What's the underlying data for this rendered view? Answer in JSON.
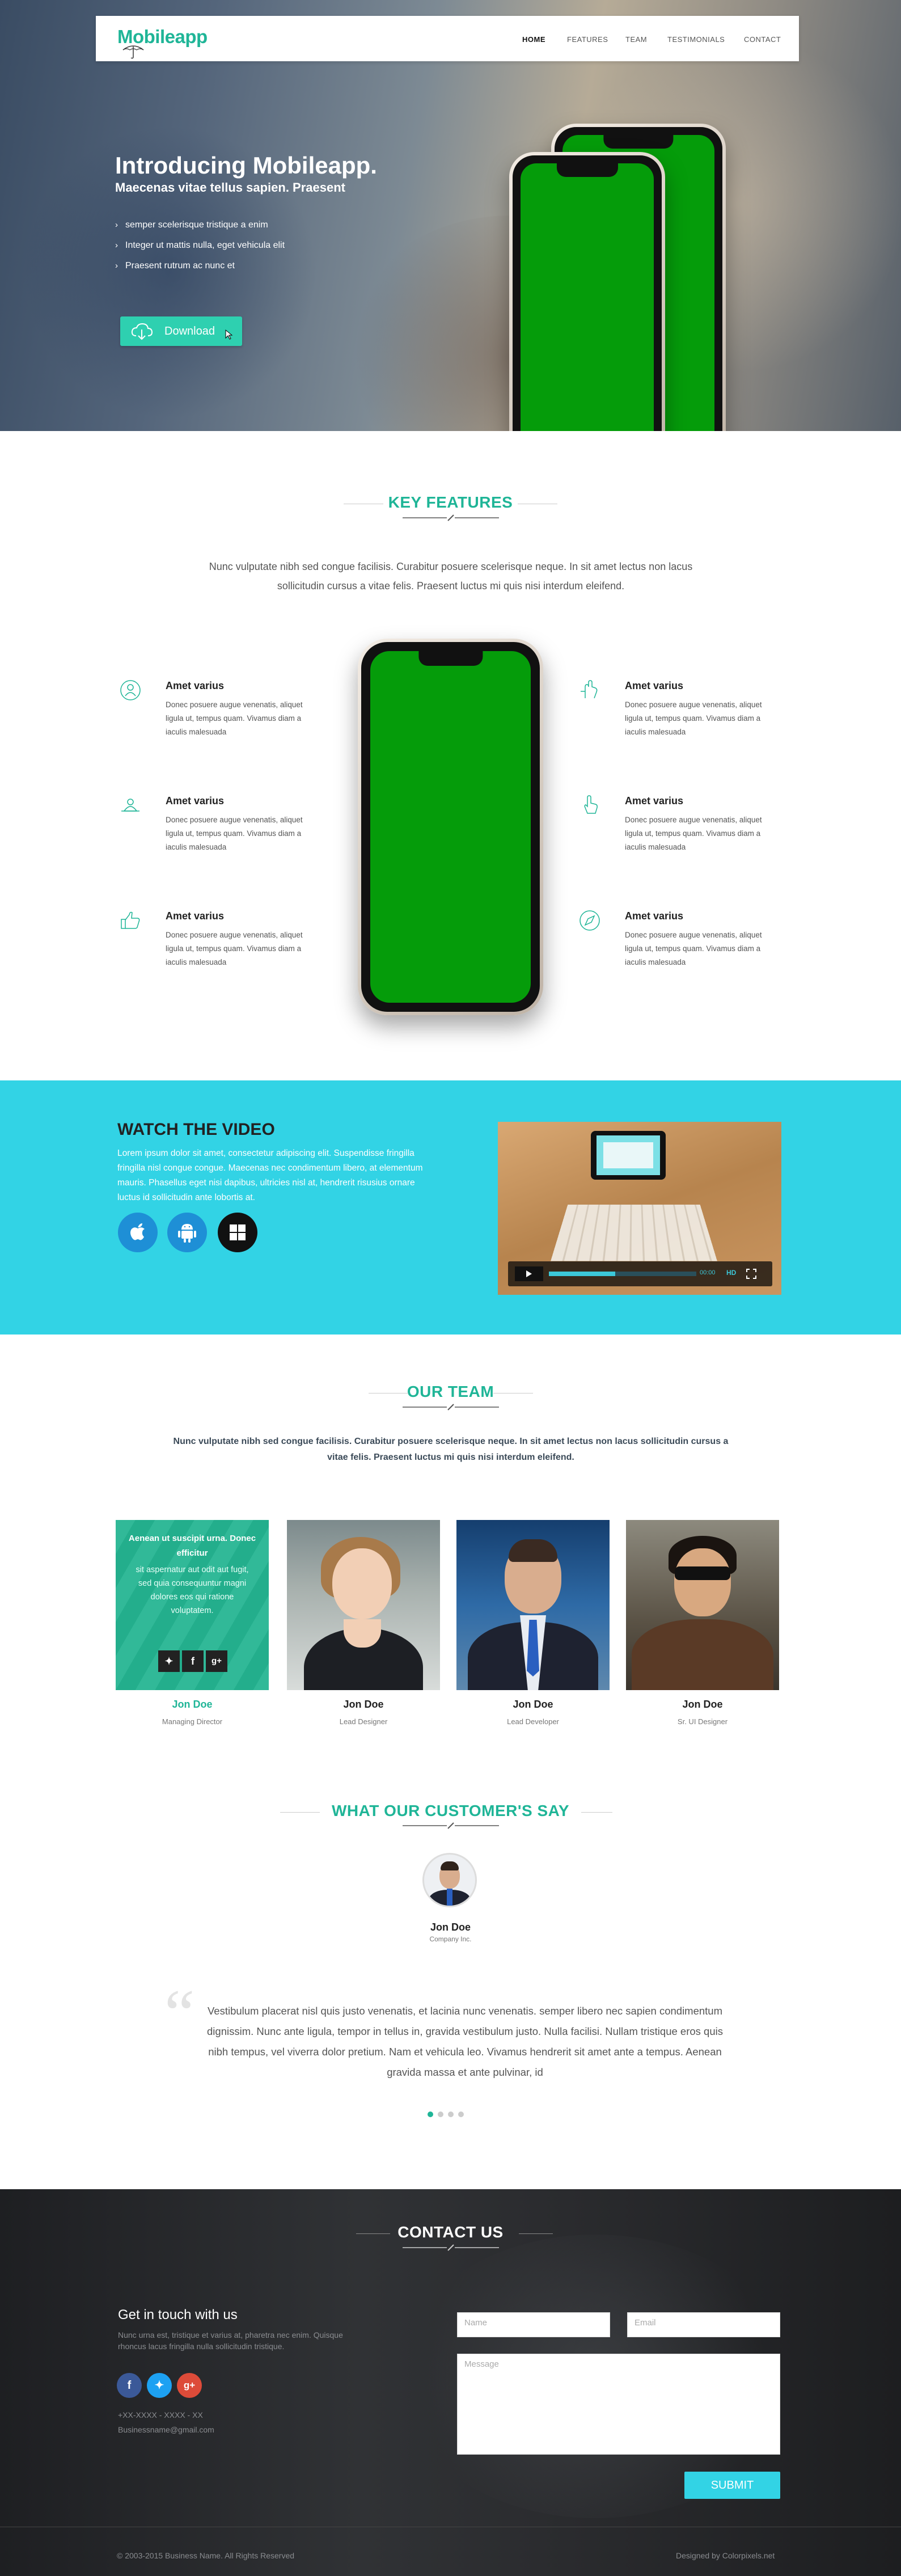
{
  "nav": {
    "logo": "Mobileapp",
    "links": [
      "HOME",
      "FEATURES",
      "TEAM",
      "TESTIMONIALS",
      "CONTACT"
    ]
  },
  "hero": {
    "title": "Introducing Mobileapp.",
    "subtitle": "Maecenas vitae tellus sapien. Praesent",
    "bullets": [
      "semper scelerisque tristique a enim",
      "Integer ut mattis nulla, eget vehicula elit",
      "Praesent rutrum ac nunc et"
    ],
    "download_label": "Download"
  },
  "features": {
    "title": "KEY FEATURES",
    "intro": "Nunc vulputate nibh sed congue facilisis. Curabitur posuere scelerisque neque. In sit amet lectus non lacus sollicitudin cursus a vitae felis. Praesent luctus mi quis nisi interdum eleifend.",
    "items": [
      {
        "title": "Amet varius",
        "text": "Donec posuere augue venenatis, aliquet ligula ut, tempus quam. Vivamus diam a iaculis malesuada",
        "icon": "user-icon"
      },
      {
        "title": "Amet varius",
        "text": "Donec posuere augue venenatis, aliquet ligula ut, tempus quam. Vivamus diam a iaculis malesuada",
        "icon": "users-icon"
      },
      {
        "title": "Amet varius",
        "text": "Donec posuere augue venenatis, aliquet ligula ut, tempus quam. Vivamus diam a iaculis malesuada",
        "icon": "thumbs-up-icon"
      },
      {
        "title": "Amet varius",
        "text": "Donec posuere augue venenatis, aliquet ligula ut, tempus quam. Vivamus diam a iaculis malesuada",
        "icon": "hand-icon"
      },
      {
        "title": "Amet varius",
        "text": "Donec posuere augue venenatis, aliquet ligula ut, tempus quam. Vivamus diam a iaculis malesuada",
        "icon": "pointer-icon"
      },
      {
        "title": "Amet varius",
        "text": "Donec posuere augue venenatis, aliquet ligula ut, tempus quam. Vivamus diam a iaculis malesuada",
        "icon": "compass-icon"
      }
    ]
  },
  "video": {
    "title": "WATCH THE VIDEO",
    "text": "Lorem ipsum dolor sit amet, consectetur adipiscing elit. Suspendisse fringilla fringilla nisl congue congue. Maecenas nec condimentum libero, at elementum mauris. Phasellus eget nisi dapibus, ultricies nisl at, hendrerit risusius ornare luctus id sollicitudin ante lobortis at.",
    "os_buttons": [
      "apple-icon",
      "android-icon",
      "windows-icon"
    ],
    "player_time": "00:00",
    "player_hd": "HD"
  },
  "team": {
    "title": "OUR TEAM",
    "intro": "Nunc vulputate nibh sed congue facilisis. Curabitur posuere scelerisque neque. In sit amet lectus non lacus sollicitudin cursus a vitae felis. Praesent luctus mi quis nisi interdum eleifend.",
    "overlay": {
      "title": "Aenean ut suscipit urna. Donec efficitur",
      "text": "sit aspernatur aut odit aut fugit, sed quia consequuntur magni dolores eos qui ratione voluptatem."
    },
    "members": [
      {
        "name": "Jon Doe",
        "role": "Managing Director"
      },
      {
        "name": "Jon Doe",
        "role": "Lead Designer"
      },
      {
        "name": "Jon Doe",
        "role": "Lead Developer"
      },
      {
        "name": "Jon Doe",
        "role": "Sr. UI Designer"
      }
    ]
  },
  "testimonials": {
    "title": "WHAT OUR CUSTOMER'S SAY",
    "name": "Jon Doe",
    "company": "Company Inc.",
    "quote": "Vestibulum placerat nisl quis justo venenatis, et lacinia nunc venenatis. semper libero nec sapien condimentum dignissim. Nunc ante ligula, tempor in tellus in, gravida vestibulum justo. Nulla facilisi. Nullam tristique eros quis nibh tempus, vel viverra dolor pretium. Nam et vehicula leo. Vivamus hendrerit sit amet ante a tempus. Aenean gravida massa et ante pulvinar, id"
  },
  "contact": {
    "title": "CONTACT US",
    "heading": "Get in touch with us",
    "text": "Nunc urna est, tristique et varius at, pharetra nec enim. Quisque rhoncus lacus fringilla nulla sollicitudin tristique.",
    "phone": "+XX-XXXX - XXXX - XX",
    "email": "Businessname@gmail.com",
    "name_placeholder": "Name",
    "email_placeholder": "Email",
    "message_placeholder": "Message",
    "submit_label": "SUBMIT"
  },
  "footer": {
    "copyright": "© 2003-2015 Business Name. All Rights Reserved",
    "credit": "Designed by Colorpixels.net"
  },
  "colors": {
    "accent": "#1fb597",
    "cyan": "#32d3e5",
    "dark": "#2a2b2e"
  }
}
